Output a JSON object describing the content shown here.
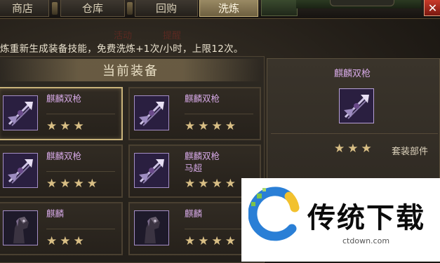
{
  "tabs": [
    {
      "label": "商店",
      "active": false
    },
    {
      "label": "仓库",
      "active": false
    },
    {
      "label": "回购",
      "active": false
    },
    {
      "label": "洗炼",
      "active": true
    }
  ],
  "ghost_labels": [
    "活动",
    "提醒"
  ],
  "info_text": "炼重新生成装备技能，免费洗炼+1次/小时，上限12次。",
  "current_equipment": {
    "title": "当前装备",
    "items": [
      {
        "name": "麒麟双枪",
        "sub": "",
        "stars": "★★★",
        "icon": "twin-spear-icon",
        "selected": true
      },
      {
        "name": "麒麟双枪",
        "sub": "",
        "stars": "★★★★",
        "icon": "twin-spear-icon",
        "selected": false
      },
      {
        "name": "麒麟双枪",
        "sub": "",
        "stars": "★★★★",
        "icon": "twin-spear-icon",
        "selected": false
      },
      {
        "name": "麒麟双枪",
        "sub": "马超",
        "stars": "★★★★",
        "icon": "twin-spear-icon",
        "selected": false
      },
      {
        "name": "麒麟",
        "sub": "",
        "stars": "★★★",
        "icon": "horse-icon",
        "selected": false
      },
      {
        "name": "麒麟",
        "sub": "",
        "stars": "★★★★",
        "icon": "horse-icon",
        "selected": false
      }
    ]
  },
  "detail": {
    "name": "麒麟双枪",
    "stars": "★★★",
    "suit_label": "套装部件"
  },
  "watermark": {
    "text": "传统下载",
    "url": "ctdown.com"
  },
  "close_glyph": "✕",
  "colors": {
    "item_name": "#d5a8e5",
    "star": "#d9bf85",
    "active_tab": "#8a7a55"
  }
}
